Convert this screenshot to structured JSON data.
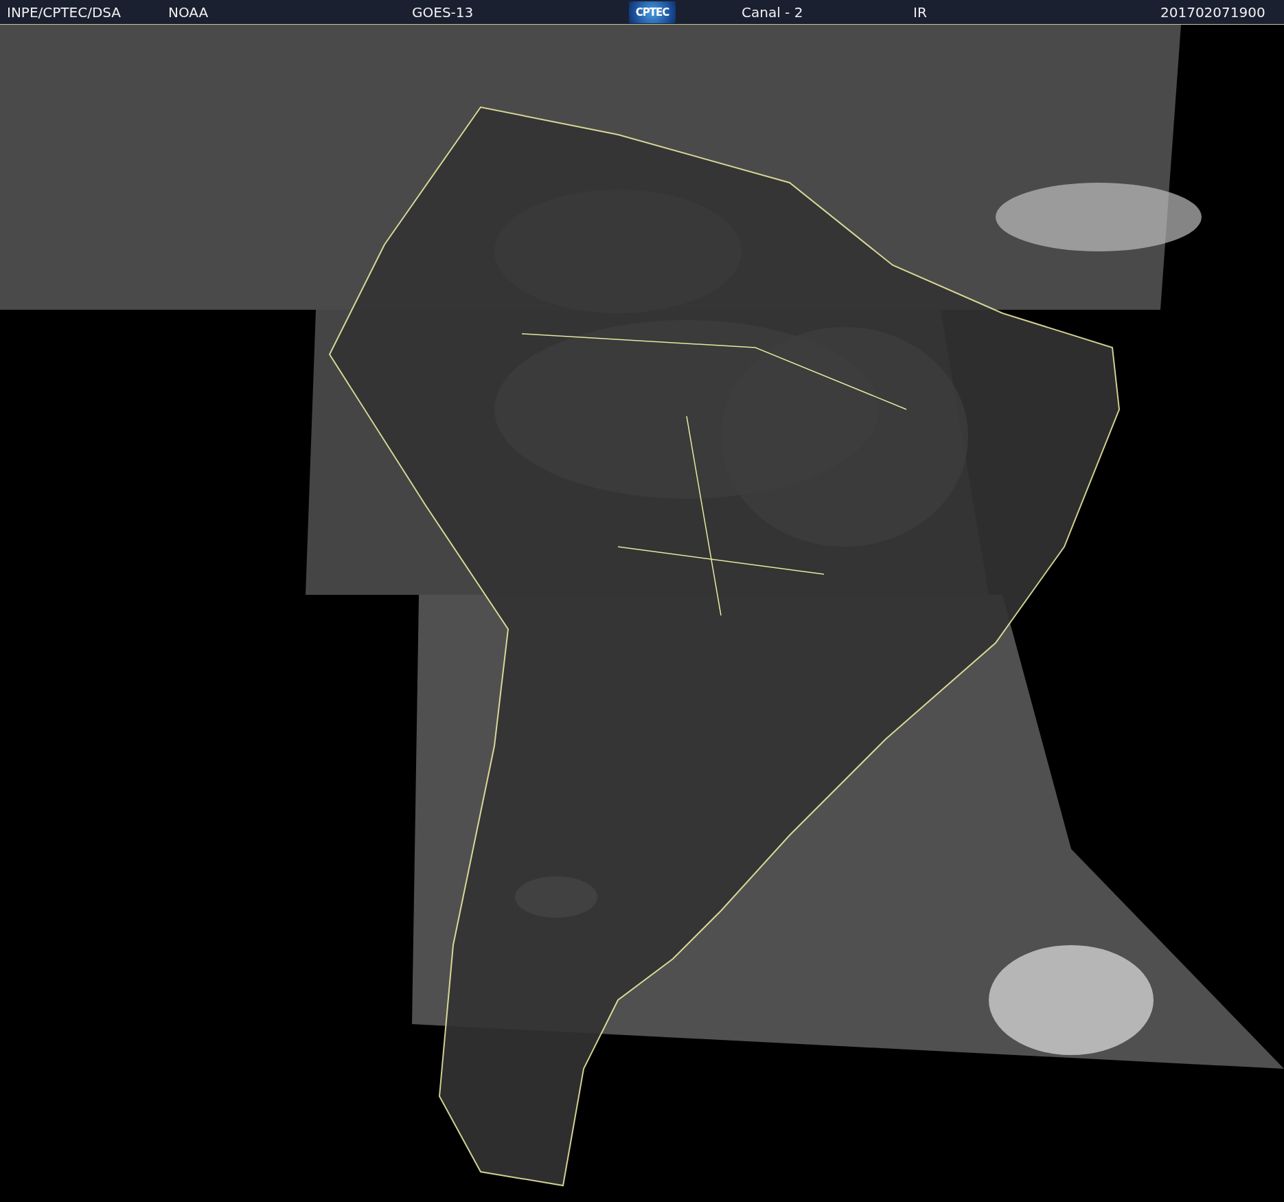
{
  "header": {
    "items": [
      {
        "kind": "text",
        "text": "INPE/CPTEC/DSA"
      },
      {
        "kind": "text",
        "text": "NOAA"
      },
      {
        "kind": "text",
        "text": "GOES-13"
      },
      {
        "kind": "logo",
        "text": "CPTEC"
      },
      {
        "kind": "text",
        "text": "Canal - 2"
      },
      {
        "kind": "text",
        "text": "IR"
      },
      {
        "kind": "text",
        "text": "201702071900"
      }
    ]
  }
}
